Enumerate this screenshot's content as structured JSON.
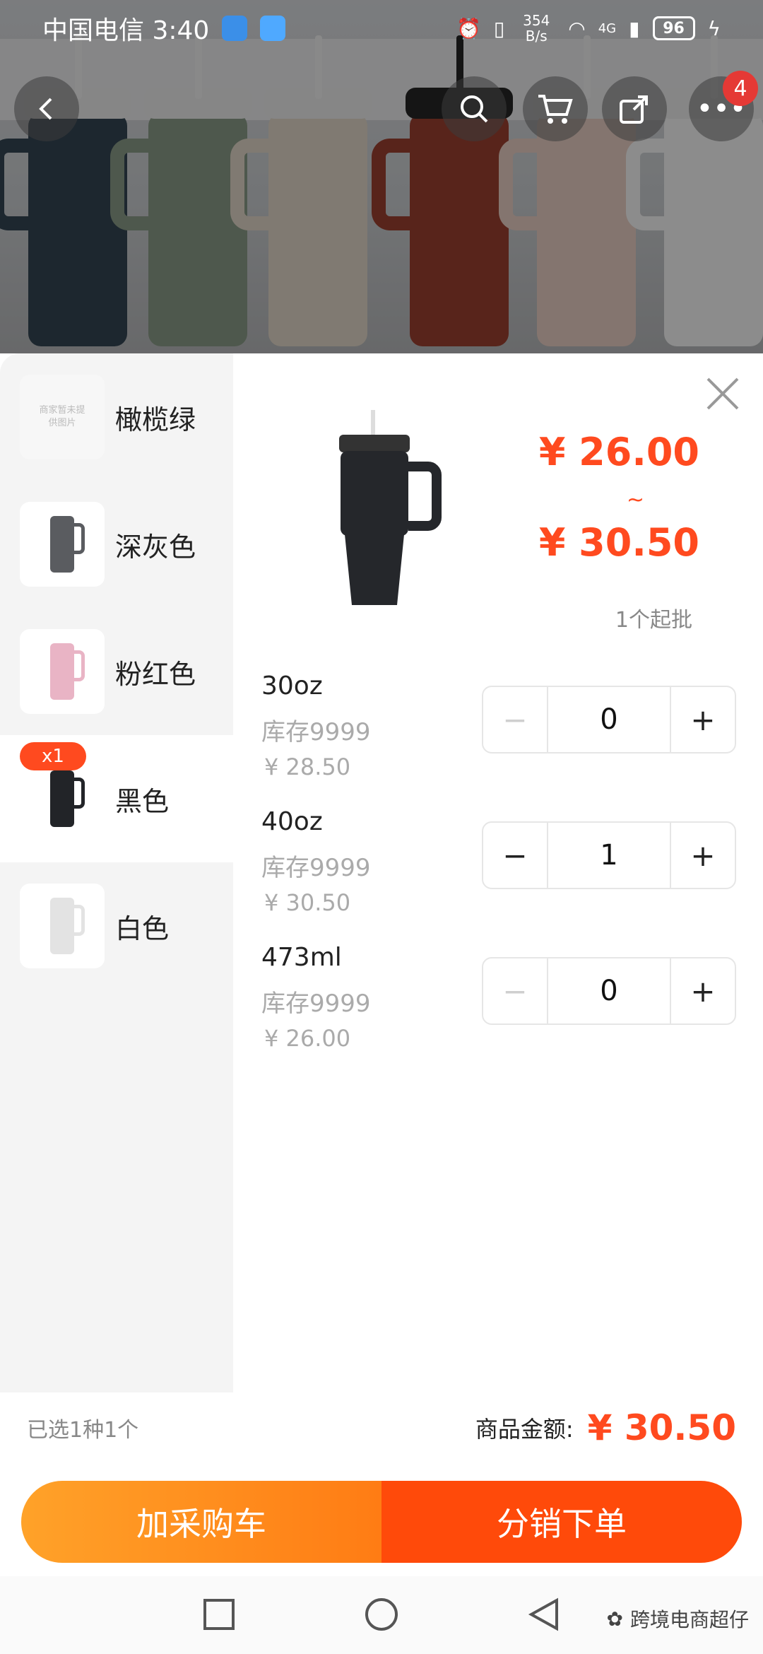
{
  "status_bar": {
    "carrier_time": "中国电信 3:40",
    "net_speed": "354 B/s",
    "signal": "4G",
    "battery": "96"
  },
  "top_actions": {
    "cart_badge": "4"
  },
  "sidebar": {
    "items": [
      {
        "label": "橄榄绿",
        "thumb_note": "商家暂未提供图片",
        "cup_color": "#7c8a6a",
        "selected_count": ""
      },
      {
        "label": "深灰色",
        "thumb_note": "",
        "cup_color": "#5a5c60",
        "selected_count": ""
      },
      {
        "label": "粉红色",
        "thumb_note": "",
        "cup_color": "#e9b4c5",
        "selected_count": ""
      },
      {
        "label": "黑色",
        "thumb_note": "",
        "cup_color": "#222428",
        "selected_count": "x1"
      },
      {
        "label": "白色",
        "thumb_note": "",
        "cup_color": "#e6e6e6",
        "selected_count": ""
      }
    ]
  },
  "product": {
    "price_low": "¥ 26.00",
    "price_sep": "~",
    "price_high": "¥ 30.50",
    "min_batch": "1个起批"
  },
  "variants": [
    {
      "name": "30oz",
      "stock": "库存9999",
      "price": "¥ 28.50",
      "qty": "0",
      "minus": "−",
      "plus": "+"
    },
    {
      "name": "40oz",
      "stock": "库存9999",
      "price": "¥ 30.50",
      "qty": "1",
      "minus": "−",
      "plus": "+"
    },
    {
      "name": "473ml",
      "stock": "库存9999",
      "price": "¥ 26.00",
      "qty": "0",
      "minus": "−",
      "plus": "+"
    }
  ],
  "summary": {
    "selected": "已选1种1个",
    "amount_label": "商品金额:",
    "amount": "¥ 30.50"
  },
  "actions": {
    "add_cart": "加采购车",
    "order": "分销下单"
  },
  "watermark": "跨境电商超仔",
  "colors": {
    "accent": "#ff4a1f",
    "cart_button_start": "#ffa229",
    "order_button": "#ff4a0a"
  }
}
